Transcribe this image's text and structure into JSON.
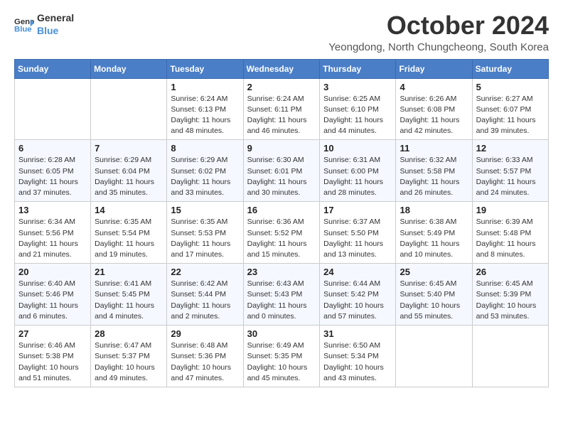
{
  "logo": {
    "line1": "General",
    "line2": "Blue",
    "arrow_color": "#4a90d9"
  },
  "title": "October 2024",
  "subtitle": "Yeongdong, North Chungcheong, South Korea",
  "days_of_week": [
    "Sunday",
    "Monday",
    "Tuesday",
    "Wednesday",
    "Thursday",
    "Friday",
    "Saturday"
  ],
  "weeks": [
    [
      {
        "day": "",
        "detail": ""
      },
      {
        "day": "",
        "detail": ""
      },
      {
        "day": "1",
        "detail": "Sunrise: 6:24 AM\nSunset: 6:13 PM\nDaylight: 11 hours and 48 minutes."
      },
      {
        "day": "2",
        "detail": "Sunrise: 6:24 AM\nSunset: 6:11 PM\nDaylight: 11 hours and 46 minutes."
      },
      {
        "day": "3",
        "detail": "Sunrise: 6:25 AM\nSunset: 6:10 PM\nDaylight: 11 hours and 44 minutes."
      },
      {
        "day": "4",
        "detail": "Sunrise: 6:26 AM\nSunset: 6:08 PM\nDaylight: 11 hours and 42 minutes."
      },
      {
        "day": "5",
        "detail": "Sunrise: 6:27 AM\nSunset: 6:07 PM\nDaylight: 11 hours and 39 minutes."
      }
    ],
    [
      {
        "day": "6",
        "detail": "Sunrise: 6:28 AM\nSunset: 6:05 PM\nDaylight: 11 hours and 37 minutes."
      },
      {
        "day": "7",
        "detail": "Sunrise: 6:29 AM\nSunset: 6:04 PM\nDaylight: 11 hours and 35 minutes."
      },
      {
        "day": "8",
        "detail": "Sunrise: 6:29 AM\nSunset: 6:02 PM\nDaylight: 11 hours and 33 minutes."
      },
      {
        "day": "9",
        "detail": "Sunrise: 6:30 AM\nSunset: 6:01 PM\nDaylight: 11 hours and 30 minutes."
      },
      {
        "day": "10",
        "detail": "Sunrise: 6:31 AM\nSunset: 6:00 PM\nDaylight: 11 hours and 28 minutes."
      },
      {
        "day": "11",
        "detail": "Sunrise: 6:32 AM\nSunset: 5:58 PM\nDaylight: 11 hours and 26 minutes."
      },
      {
        "day": "12",
        "detail": "Sunrise: 6:33 AM\nSunset: 5:57 PM\nDaylight: 11 hours and 24 minutes."
      }
    ],
    [
      {
        "day": "13",
        "detail": "Sunrise: 6:34 AM\nSunset: 5:56 PM\nDaylight: 11 hours and 21 minutes."
      },
      {
        "day": "14",
        "detail": "Sunrise: 6:35 AM\nSunset: 5:54 PM\nDaylight: 11 hours and 19 minutes."
      },
      {
        "day": "15",
        "detail": "Sunrise: 6:35 AM\nSunset: 5:53 PM\nDaylight: 11 hours and 17 minutes."
      },
      {
        "day": "16",
        "detail": "Sunrise: 6:36 AM\nSunset: 5:52 PM\nDaylight: 11 hours and 15 minutes."
      },
      {
        "day": "17",
        "detail": "Sunrise: 6:37 AM\nSunset: 5:50 PM\nDaylight: 11 hours and 13 minutes."
      },
      {
        "day": "18",
        "detail": "Sunrise: 6:38 AM\nSunset: 5:49 PM\nDaylight: 11 hours and 10 minutes."
      },
      {
        "day": "19",
        "detail": "Sunrise: 6:39 AM\nSunset: 5:48 PM\nDaylight: 11 hours and 8 minutes."
      }
    ],
    [
      {
        "day": "20",
        "detail": "Sunrise: 6:40 AM\nSunset: 5:46 PM\nDaylight: 11 hours and 6 minutes."
      },
      {
        "day": "21",
        "detail": "Sunrise: 6:41 AM\nSunset: 5:45 PM\nDaylight: 11 hours and 4 minutes."
      },
      {
        "day": "22",
        "detail": "Sunrise: 6:42 AM\nSunset: 5:44 PM\nDaylight: 11 hours and 2 minutes."
      },
      {
        "day": "23",
        "detail": "Sunrise: 6:43 AM\nSunset: 5:43 PM\nDaylight: 11 hours and 0 minutes."
      },
      {
        "day": "24",
        "detail": "Sunrise: 6:44 AM\nSunset: 5:42 PM\nDaylight: 10 hours and 57 minutes."
      },
      {
        "day": "25",
        "detail": "Sunrise: 6:45 AM\nSunset: 5:40 PM\nDaylight: 10 hours and 55 minutes."
      },
      {
        "day": "26",
        "detail": "Sunrise: 6:45 AM\nSunset: 5:39 PM\nDaylight: 10 hours and 53 minutes."
      }
    ],
    [
      {
        "day": "27",
        "detail": "Sunrise: 6:46 AM\nSunset: 5:38 PM\nDaylight: 10 hours and 51 minutes."
      },
      {
        "day": "28",
        "detail": "Sunrise: 6:47 AM\nSunset: 5:37 PM\nDaylight: 10 hours and 49 minutes."
      },
      {
        "day": "29",
        "detail": "Sunrise: 6:48 AM\nSunset: 5:36 PM\nDaylight: 10 hours and 47 minutes."
      },
      {
        "day": "30",
        "detail": "Sunrise: 6:49 AM\nSunset: 5:35 PM\nDaylight: 10 hours and 45 minutes."
      },
      {
        "day": "31",
        "detail": "Sunrise: 6:50 AM\nSunset: 5:34 PM\nDaylight: 10 hours and 43 minutes."
      },
      {
        "day": "",
        "detail": ""
      },
      {
        "day": "",
        "detail": ""
      }
    ]
  ]
}
